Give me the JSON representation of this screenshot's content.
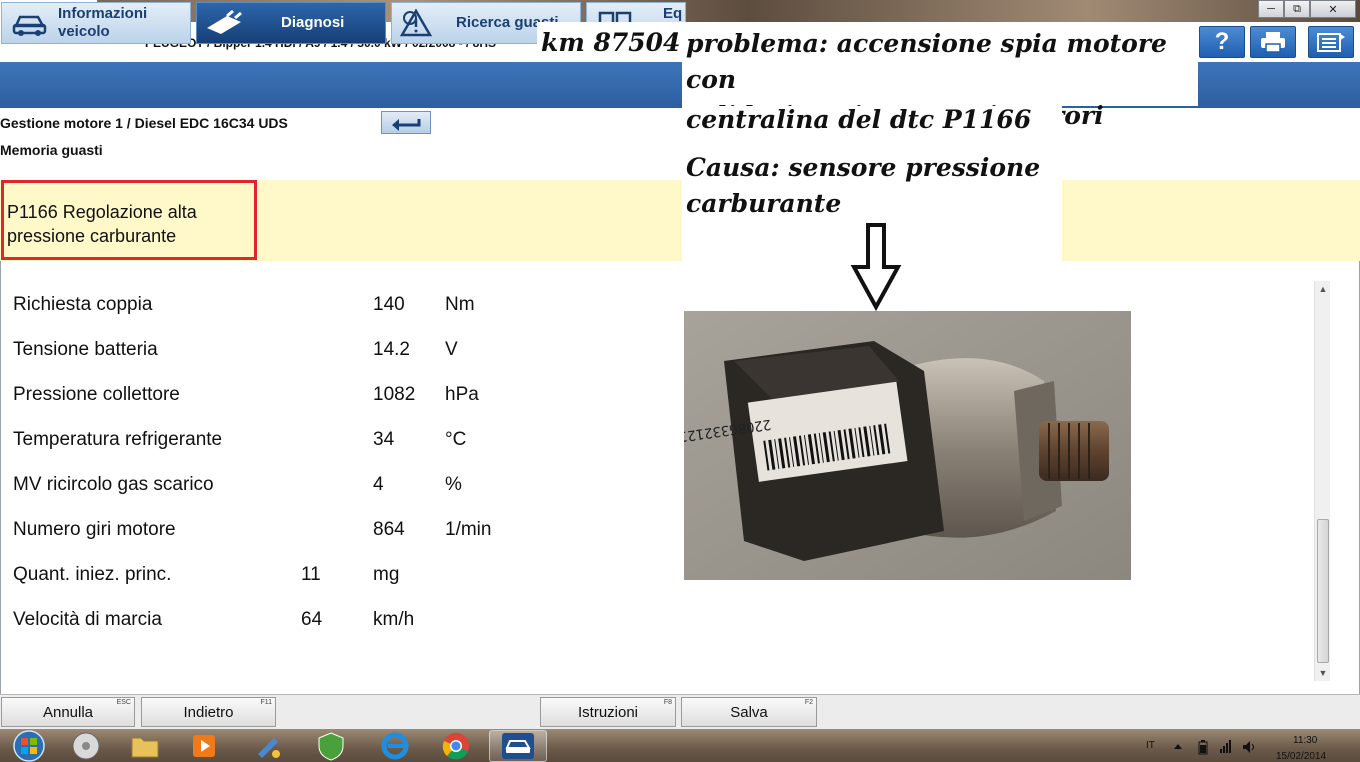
{
  "window": {
    "vehicle_line": "PEUGEOT / Bipper 1.4 HDi / A9 / 1.4 / 50.0 kW / 02/2008 - / 8HS"
  },
  "nav": {
    "vehicle_info_line1": "Informazioni",
    "vehicle_info_line2": "veicolo",
    "diagnosis": "Diagnosi",
    "fault_search": "Ricerca guasti",
    "equipment_line1": "Eq",
    "equipment_line2": "me"
  },
  "header_buttons": {
    "help": "?"
  },
  "breadcrumb": {
    "ecu": "Gestione motore 1 / Diesel EDC 16C34 UDS",
    "section": "Memoria guasti"
  },
  "fault": {
    "line1": "P1166  Regolazione alta",
    "line2": "pressione carburante"
  },
  "params": [
    {
      "label": "Richiesta coppia",
      "value": "140",
      "unit": "Nm"
    },
    {
      "label": "Tensione batteria",
      "value": "14.2",
      "unit": "V"
    },
    {
      "label": "Pressione collettore",
      "value": "1082",
      "unit": "hPa"
    },
    {
      "label": "Temperatura refrigerante",
      "value": "34",
      "unit": "°C"
    },
    {
      "label": "MV ricircolo gas scarico",
      "value": "4",
      "unit": "%"
    },
    {
      "label": "Numero giri motore",
      "value": "864",
      "unit": "1/min"
    },
    {
      "label": "Quant. iniez. princ.",
      "value": "11",
      "unit": "mg"
    },
    {
      "label": "Velocità di marcia",
      "value": "64",
      "unit": "km/h"
    }
  ],
  "annotation": {
    "km": "km 87504",
    "problem_line1": "problema: accensione spia motore con",
    "problem_line2": "validazione in memoria errori",
    "problem_line3": "centralina del dtc P1166",
    "cause_line1": "Causa: sensore pressione",
    "cause_line2": "carburante"
  },
  "photo": {
    "barcode_text": "2208G3321210"
  },
  "footer": {
    "cancel": "Annulla",
    "cancel_key": "ESC",
    "back": "Indietro",
    "back_key": "F11",
    "instructions": "Istruzioni",
    "instructions_key": "F8",
    "save": "Salva",
    "save_key": "F2"
  },
  "taskbar": {
    "language": "IT",
    "time": "11:30",
    "date": "15/02/2014"
  },
  "colors": {
    "accent": "#2c5f9f",
    "fault_bg": "#fff8c8",
    "fault_border": "#e0252c"
  }
}
